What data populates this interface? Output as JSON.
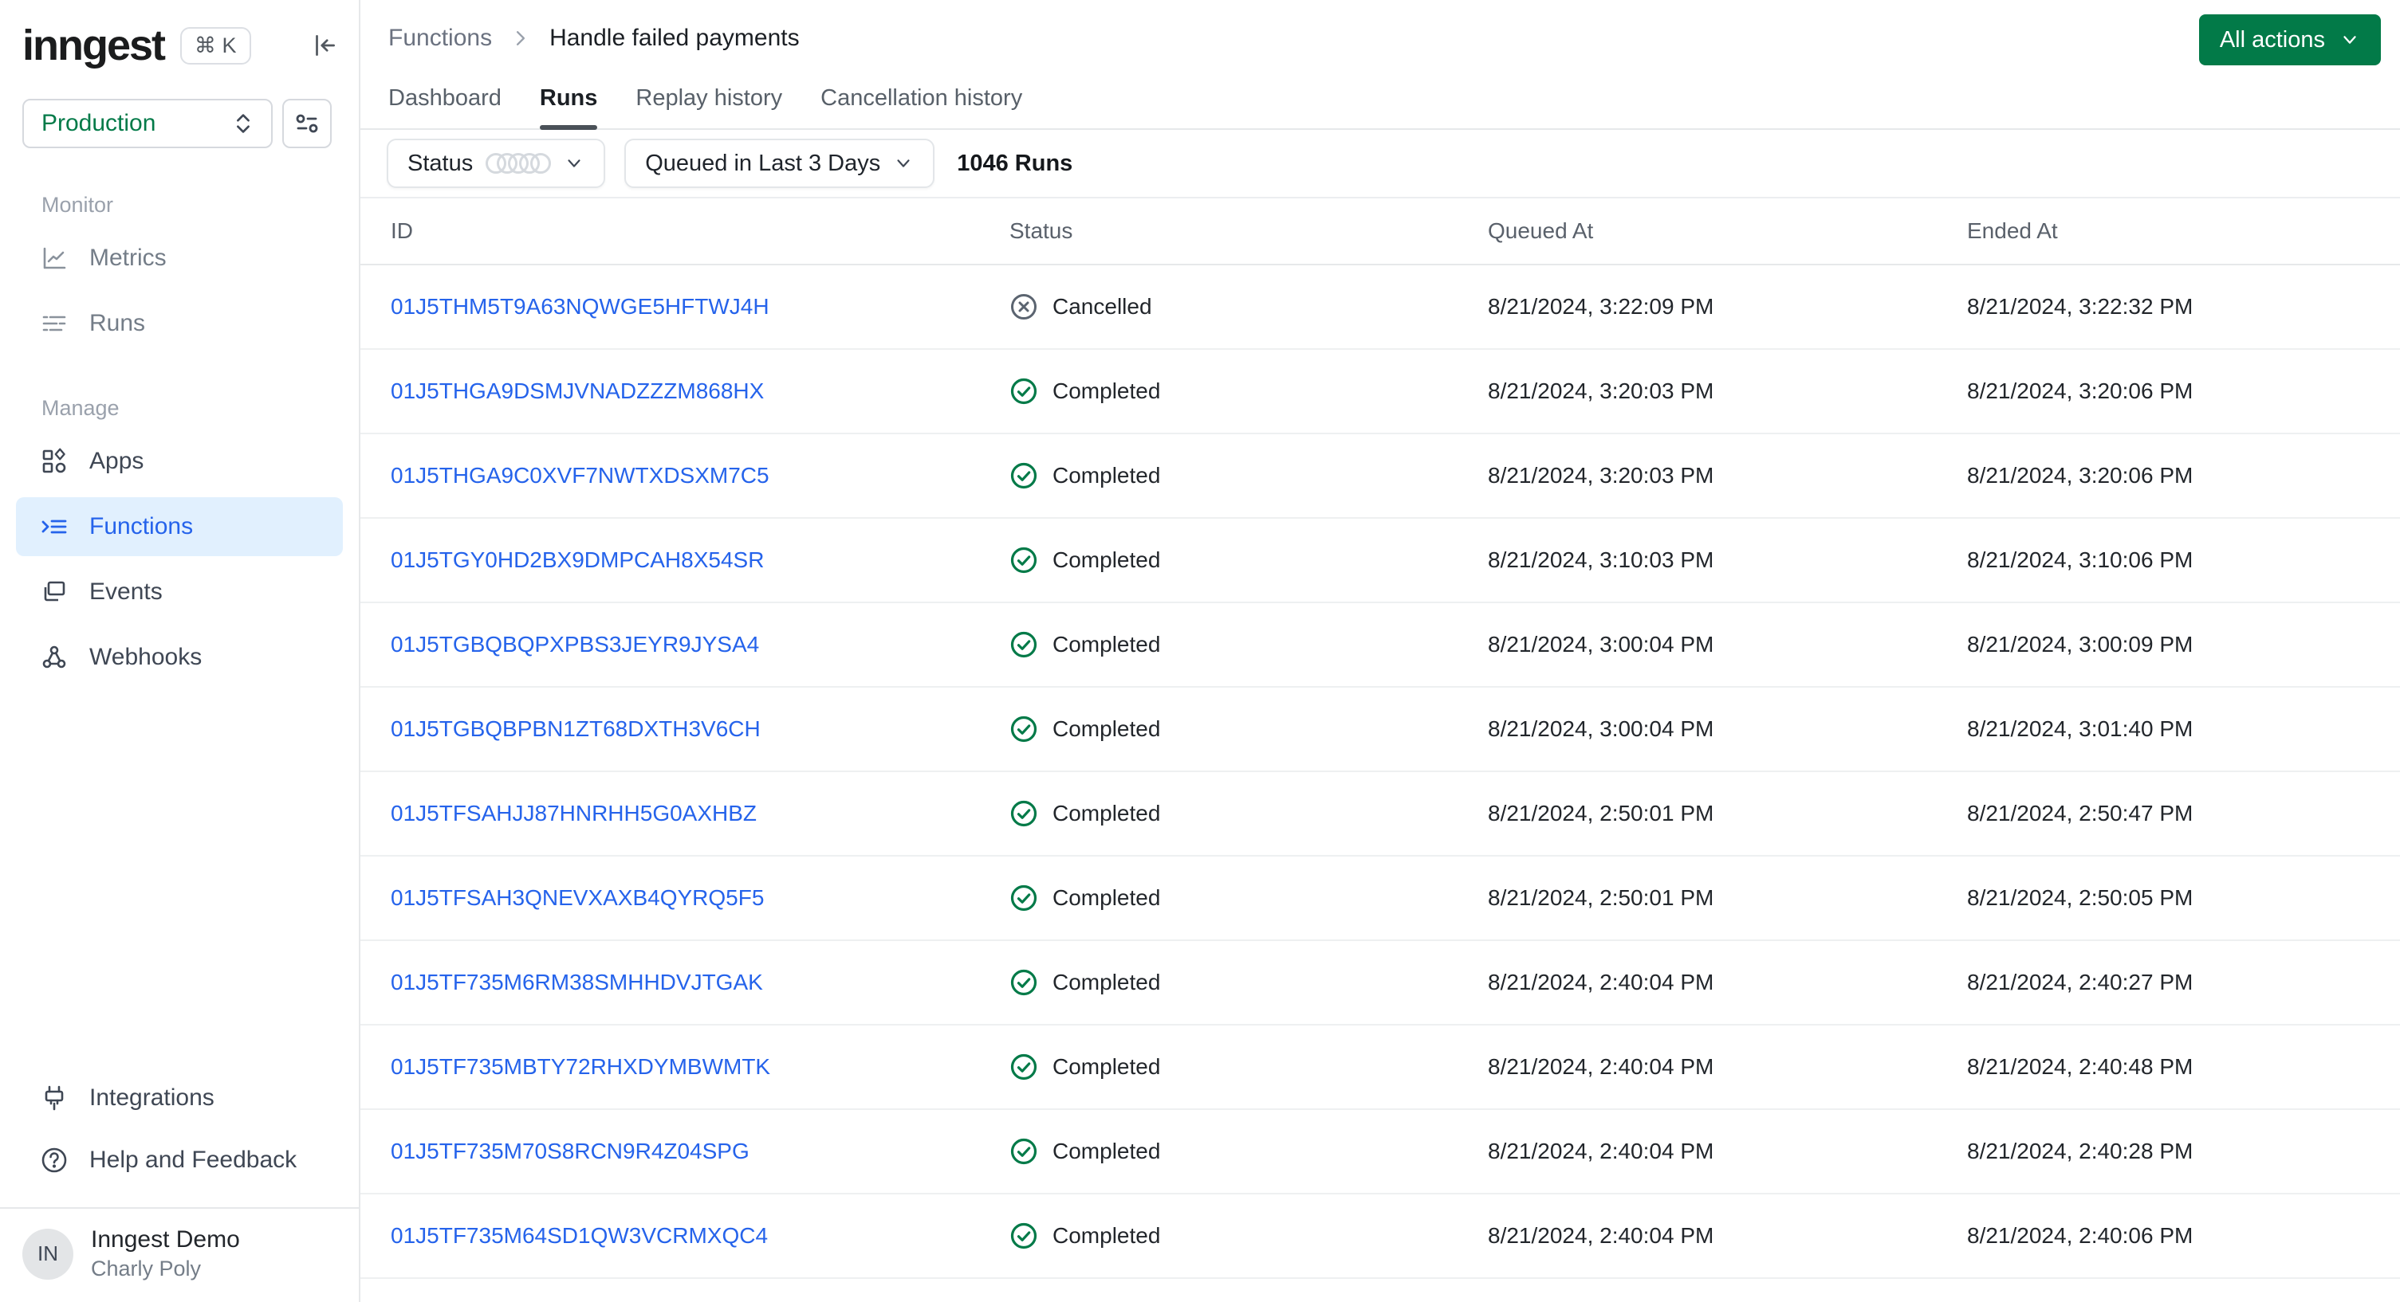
{
  "sidebar": {
    "logo": "inngest",
    "shortcut": "⌘ K",
    "collapse_icon": "collapse-sidebar-icon",
    "env_selector": {
      "value": "Production",
      "settings_icon": "env-settings-icon"
    },
    "sections": [
      {
        "label": "Monitor",
        "items": [
          {
            "label": "Metrics",
            "icon": "line-chart-icon"
          },
          {
            "label": "Runs",
            "icon": "list-lines-icon"
          }
        ]
      },
      {
        "label": "Manage",
        "items": [
          {
            "label": "Apps",
            "icon": "apps-shapes-icon"
          },
          {
            "label": "Functions",
            "icon": "function-list-icon",
            "active": true
          },
          {
            "label": "Events",
            "icon": "windows-icon"
          },
          {
            "label": "Webhooks",
            "icon": "webhook-icon"
          }
        ]
      }
    ],
    "footer_items": [
      {
        "label": "Integrations",
        "icon": "plug-icon"
      },
      {
        "label": "Help and Feedback",
        "icon": "question-circle-icon"
      }
    ],
    "user": {
      "initials": "IN",
      "name": "Inngest Demo",
      "org": "Charly Poly"
    }
  },
  "header": {
    "breadcrumb": {
      "root": "Functions",
      "current": "Handle failed payments"
    },
    "action_button": "All actions",
    "tabs": [
      {
        "label": "Dashboard"
      },
      {
        "label": "Runs",
        "active": true
      },
      {
        "label": "Replay history"
      },
      {
        "label": "Cancellation history"
      }
    ]
  },
  "filters": {
    "status_label": "Status",
    "status_ring_count": 5,
    "time_range": "Queued in Last 3 Days",
    "run_count": "1046 Runs"
  },
  "table": {
    "columns": [
      "ID",
      "Status",
      "Queued At",
      "Ended At"
    ],
    "rows": [
      {
        "id": "01J5THM5T9A63NQWGE5HFTWJ4H",
        "status": "Cancelled",
        "queued_at": "8/21/2024, 3:22:09 PM",
        "ended_at": "8/21/2024, 3:22:32 PM"
      },
      {
        "id": "01J5THGA9DSMJVNADZZZM868HX",
        "status": "Completed",
        "queued_at": "8/21/2024, 3:20:03 PM",
        "ended_at": "8/21/2024, 3:20:06 PM"
      },
      {
        "id": "01J5THGA9C0XVF7NWTXDSXM7C5",
        "status": "Completed",
        "queued_at": "8/21/2024, 3:20:03 PM",
        "ended_at": "8/21/2024, 3:20:06 PM"
      },
      {
        "id": "01J5TGY0HD2BX9DMPCAH8X54SR",
        "status": "Completed",
        "queued_at": "8/21/2024, 3:10:03 PM",
        "ended_at": "8/21/2024, 3:10:06 PM"
      },
      {
        "id": "01J5TGBQBQPXPBS3JEYR9JYSA4",
        "status": "Completed",
        "queued_at": "8/21/2024, 3:00:04 PM",
        "ended_at": "8/21/2024, 3:00:09 PM"
      },
      {
        "id": "01J5TGBQBPBN1ZT68DXTH3V6CH",
        "status": "Completed",
        "queued_at": "8/21/2024, 3:00:04 PM",
        "ended_at": "8/21/2024, 3:01:40 PM"
      },
      {
        "id": "01J5TFSAHJJ87HNRHH5G0AXHBZ",
        "status": "Completed",
        "queued_at": "8/21/2024, 2:50:01 PM",
        "ended_at": "8/21/2024, 2:50:47 PM"
      },
      {
        "id": "01J5TFSAH3QNEVXAXB4QYRQ5F5",
        "status": "Completed",
        "queued_at": "8/21/2024, 2:50:01 PM",
        "ended_at": "8/21/2024, 2:50:05 PM"
      },
      {
        "id": "01J5TF735M6RM38SMHHDVJTGAK",
        "status": "Completed",
        "queued_at": "8/21/2024, 2:40:04 PM",
        "ended_at": "8/21/2024, 2:40:27 PM"
      },
      {
        "id": "01J5TF735MBTY72RHXDYMBWMTK",
        "status": "Completed",
        "queued_at": "8/21/2024, 2:40:04 PM",
        "ended_at": "8/21/2024, 2:40:48 PM"
      },
      {
        "id": "01J5TF735M70S8RCN9R4Z04SPG",
        "status": "Completed",
        "queued_at": "8/21/2024, 2:40:04 PM",
        "ended_at": "8/21/2024, 2:40:28 PM"
      },
      {
        "id": "01J5TF735M64SD1QW3VCRMXQC4",
        "status": "Completed",
        "queued_at": "8/21/2024, 2:40:04 PM",
        "ended_at": "8/21/2024, 2:40:06 PM"
      }
    ]
  },
  "accents": {
    "brand_green": "#027a48",
    "link_blue": "#2563eb",
    "active_item_bg": "#e1f0fe",
    "completed_green": "#027a48",
    "cancelled_gray": "#5b6470"
  }
}
